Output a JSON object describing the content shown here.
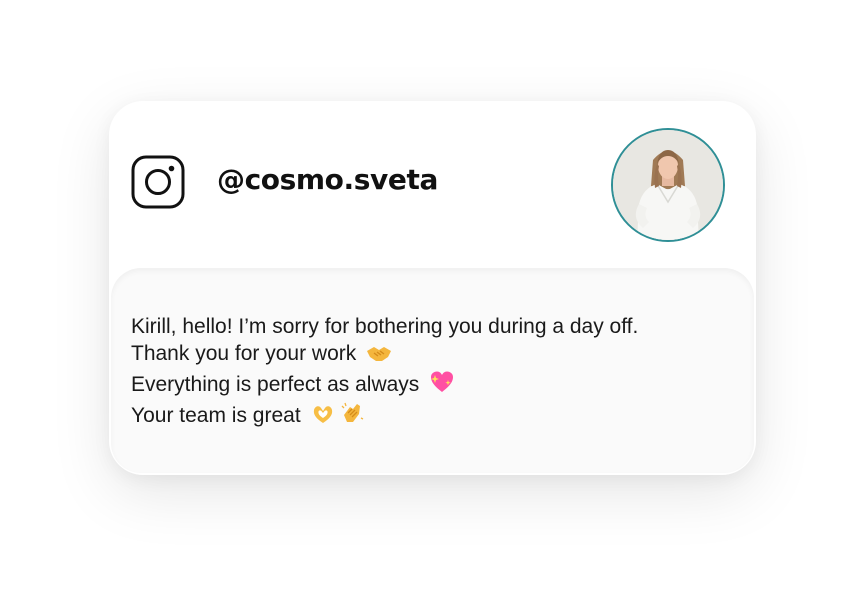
{
  "profile": {
    "handle": "@cosmo.sveta",
    "platform_icon": "instagram-icon",
    "avatar_icon": "profile-photo"
  },
  "message": {
    "lines": [
      {
        "text": "Kirill, hello! I’m sorry for bothering you during a day off.",
        "emoji": []
      },
      {
        "text": "Thank you for your work",
        "emoji": [
          "handshake-emoji"
        ]
      },
      {
        "text": "Everything is perfect as always ",
        "emoji": [
          "sparkling-heart-emoji"
        ]
      },
      {
        "text": "Your team is great",
        "emoji": [
          "heart-hands-emoji",
          "clapping-hands-emoji"
        ]
      }
    ]
  },
  "colors": {
    "avatar_ring": "#2f8f96",
    "text": "#1a1a1a"
  }
}
